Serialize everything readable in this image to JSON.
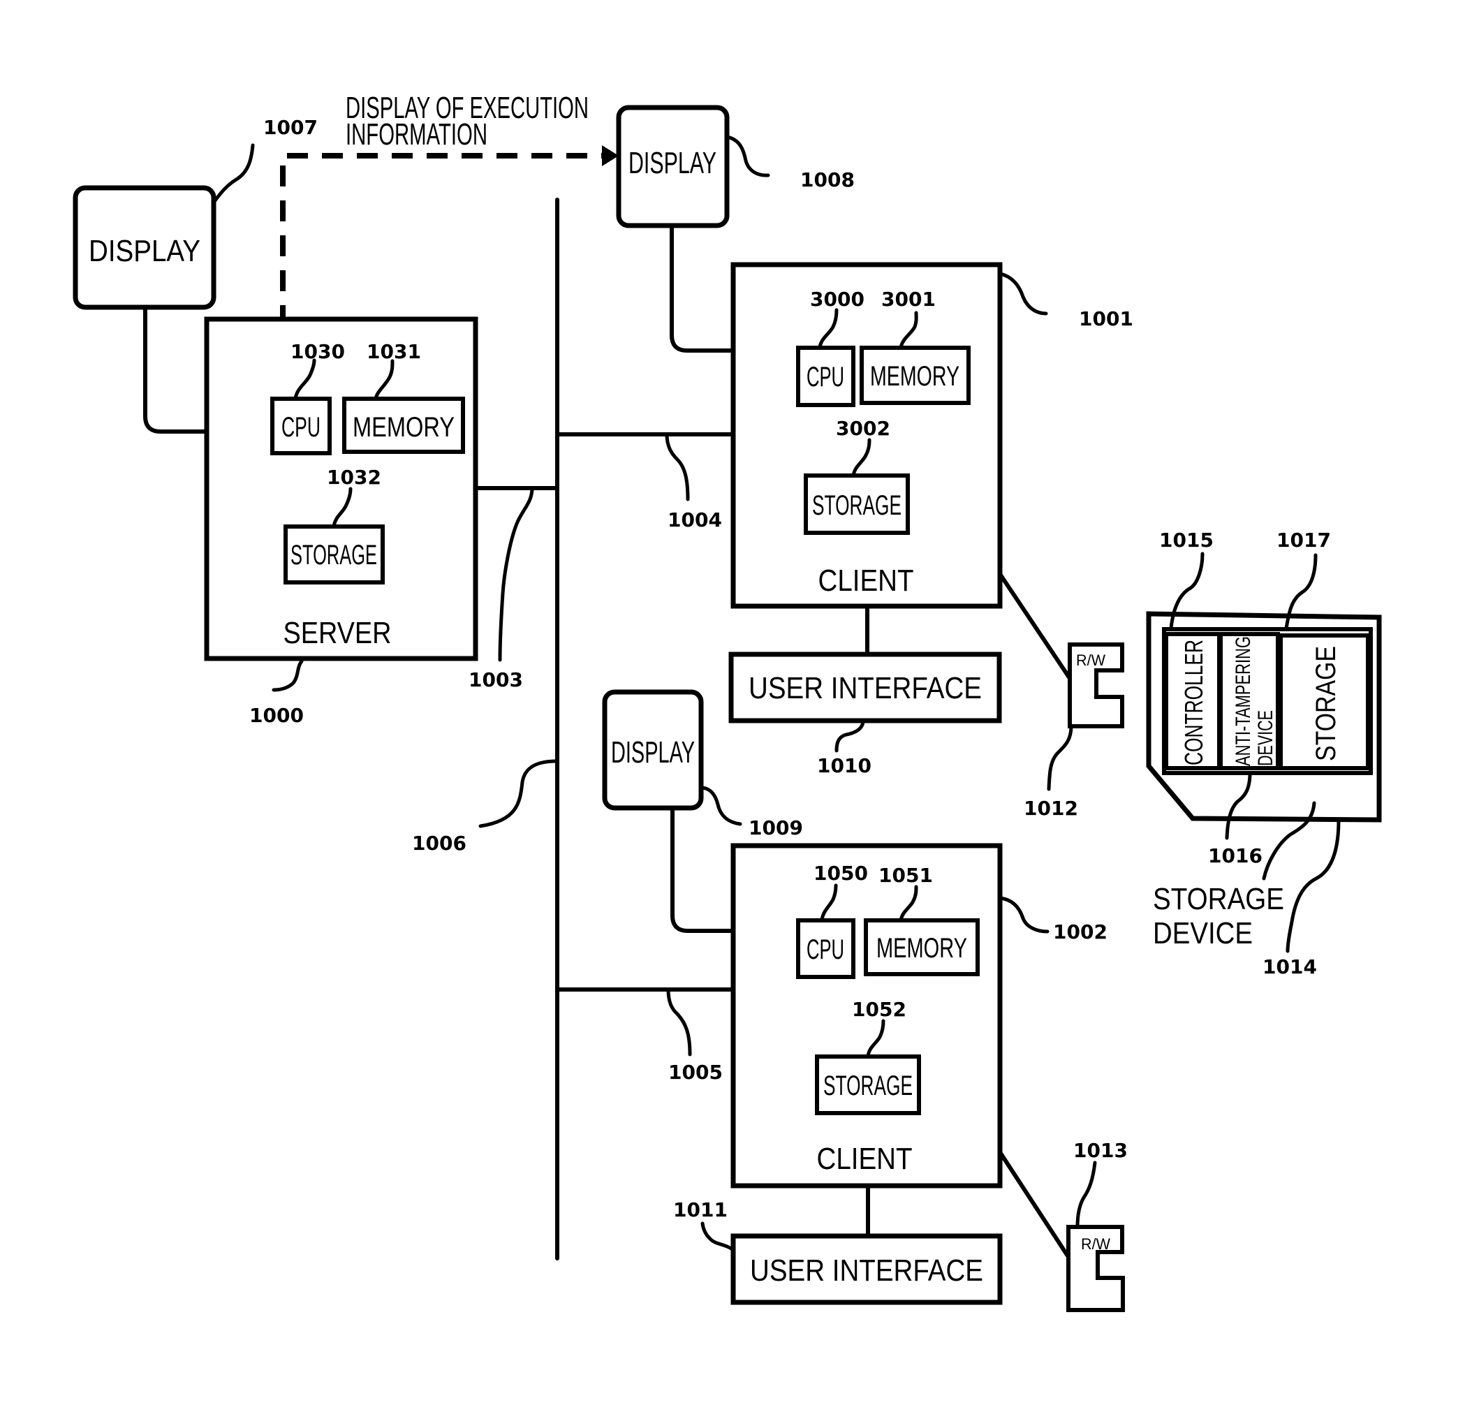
{
  "annotation": {
    "execution_info_line1": "DISPLAY OF EXECUTION",
    "execution_info_line2": "INFORMATION"
  },
  "server": {
    "label": "SERVER",
    "ref": "1000",
    "cpu": {
      "label": "CPU",
      "ref": "1030"
    },
    "memory": {
      "label": "MEMORY",
      "ref": "1031"
    },
    "storage": {
      "label": "STORAGE",
      "ref": "1032"
    },
    "display": {
      "label": "DISPLAY",
      "ref": "1007"
    },
    "network_ref": "1003"
  },
  "client1": {
    "label": "CLIENT",
    "ref": "1001",
    "cpu": {
      "label": "CPU",
      "ref": "3000"
    },
    "memory": {
      "label": "MEMORY",
      "ref": "3001"
    },
    "storage": {
      "label": "STORAGE",
      "ref": "3002"
    },
    "display": {
      "label": "DISPLAY",
      "ref": "1008"
    },
    "user_interface": {
      "label": "USER INTERFACE",
      "ref": "1010"
    },
    "reader": {
      "label": "R/W",
      "ref": "1012"
    },
    "network_ref": "1004"
  },
  "client2": {
    "label": "CLIENT",
    "ref": "1002",
    "cpu": {
      "label": "CPU",
      "ref": "1050"
    },
    "memory": {
      "label": "MEMORY",
      "ref": "1051"
    },
    "storage": {
      "label": "STORAGE",
      "ref": "1052"
    },
    "display": {
      "label": "DISPLAY",
      "ref": "1009"
    },
    "user_interface": {
      "label": "USER INTERFACE",
      "ref": "1011"
    },
    "reader": {
      "label": "R/W",
      "ref": "1013"
    },
    "network_ref": "1005"
  },
  "network": {
    "ref": "1006"
  },
  "storage_device": {
    "label_line1": "STORAGE",
    "label_line2": "DEVICE",
    "ref": "1014",
    "controller": {
      "label": "CONTROLLER",
      "ref": "1015"
    },
    "anti_tampering": {
      "label_line1": "ANTI-TAMPERING",
      "label_line2": "DEVICE",
      "ref": "1016"
    },
    "storage": {
      "label": "STORAGE",
      "ref": "1017"
    }
  }
}
